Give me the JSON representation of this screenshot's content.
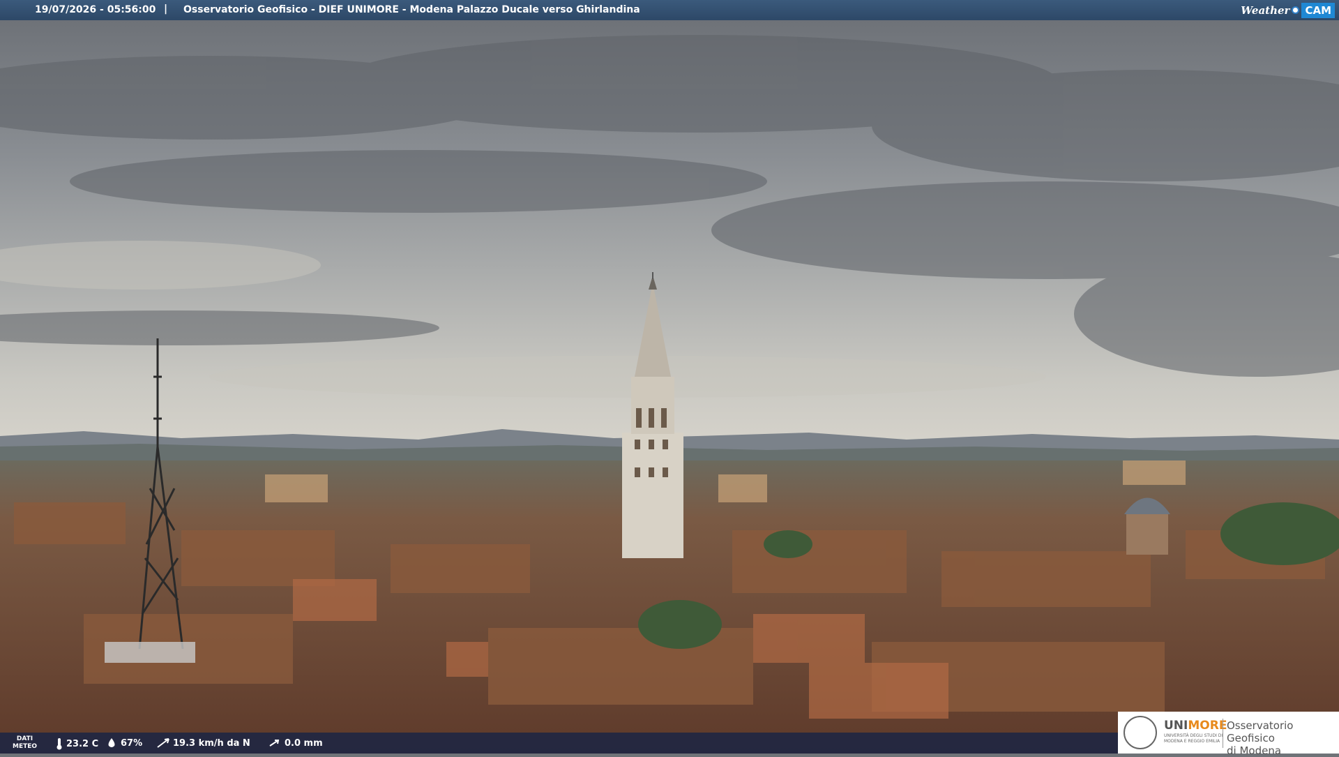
{
  "header": {
    "timestamp": "19/07/2026 - 05:56:00",
    "separator": "|",
    "title": "Osservatorio Geofisico - DIEF UNIMORE - Modena Palazzo Ducale verso Ghirlandina",
    "brand_weather": "Weather",
    "brand_cam": "CAM"
  },
  "weather": {
    "label_line1": "DATI",
    "label_line2": "METEO",
    "temperature": "23.2 C",
    "humidity": "67%",
    "wind": "19.3 km/h da N",
    "rain": "0.0 mm",
    "icons": [
      "thermometer-icon",
      "humidity-drop-icon",
      "wind-icon",
      "rain-icon"
    ]
  },
  "logo": {
    "uni_part1": "UNI",
    "uni_part2": "MORE",
    "uni_sub": "UNIVERSITÀ DEGLI STUDI DI MODENA E REGGIO EMILIA",
    "obs_line1": "Osservatorio Geofisico",
    "obs_line2": "di Modena",
    "accent": "#e88a1c"
  },
  "colors": {
    "topbar": "#2d4867",
    "bottombar": "#142346",
    "brand_cam_bg": "#1f88d4"
  }
}
